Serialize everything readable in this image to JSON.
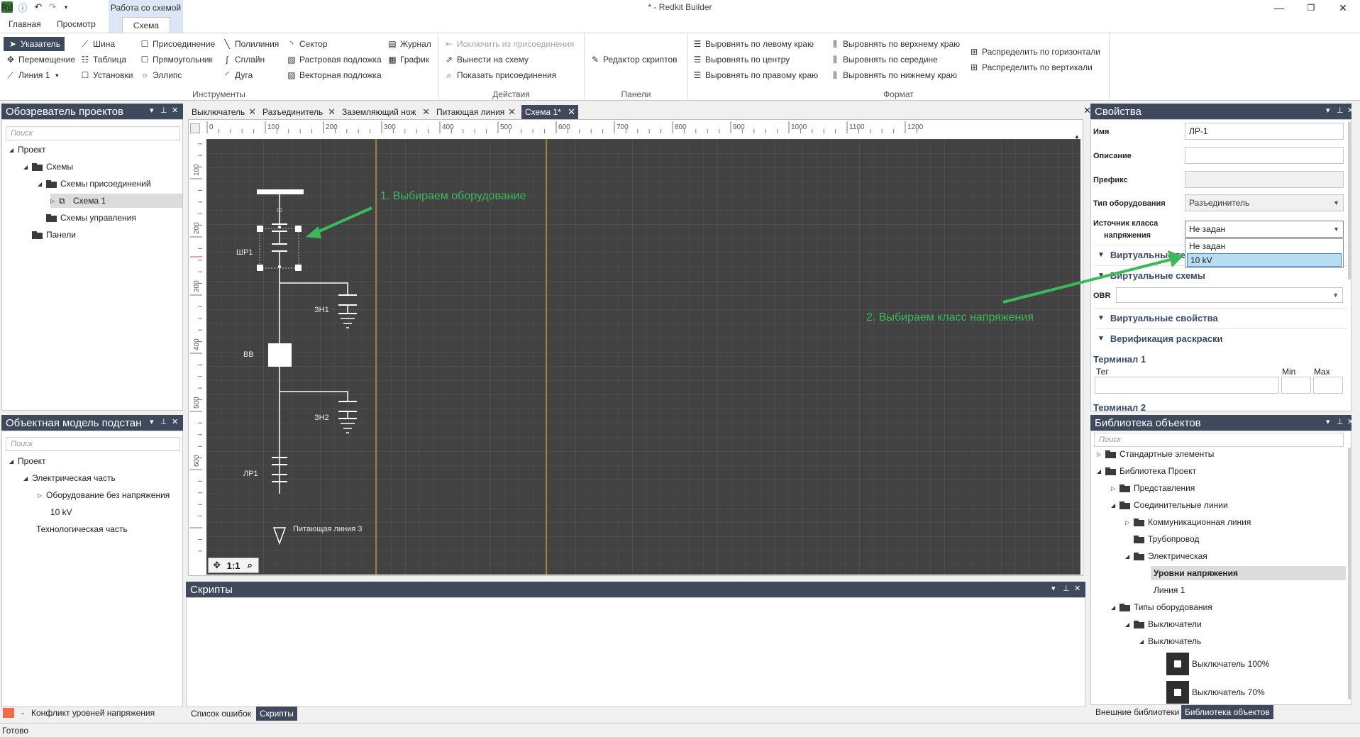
{
  "window": {
    "title": "* - Redkit Builder",
    "context_tab_title": "Работа со схемой",
    "min_icon": "minimize-icon",
    "restore_icon": "restore-icon",
    "close_icon": "close-icon"
  },
  "ribbon_tabs": [
    {
      "label": "Главная"
    },
    {
      "label": "Просмотр"
    },
    {
      "label": "Схема"
    }
  ],
  "ribbon": {
    "tools": {
      "label": "Инструменты",
      "pointer": "Указатель",
      "move": "Перемещение",
      "line": "Линия 1",
      "bus": "Шина",
      "table": "Таблица",
      "installs": "Установки",
      "connection": "Присоединение",
      "rectangle": "Прямоугольник",
      "ellipse": "Эллипс",
      "polyline": "Полилиния",
      "spline": "Сплайн",
      "arc": "Дуга",
      "sector": "Сектор",
      "raster": "Растровая подложка",
      "vector": "Векторная подложка",
      "journal": "Журнал",
      "graph": "График"
    },
    "actions": {
      "label": "Действия",
      "exclude": "Исключить из присоединения",
      "bring": "Вынести на схему",
      "show": "Показать присоединения"
    },
    "panels": {
      "label": "Панели",
      "script_editor": "Редактор скриптов"
    },
    "format": {
      "label": "Формат",
      "align_left": "Выровнять по левому краю",
      "align_center": "Выровнять по центру",
      "align_right": "Выровнять по правому краю",
      "align_top": "Выровнять по верхнему краю",
      "align_middle": "Выровнять по середине",
      "align_bottom": "Выровнять по нижнему краю",
      "dist_h": "Распределить по горизонтали",
      "dist_v": "Распределить по вертикали"
    }
  },
  "project_explorer": {
    "title": "Обозреватель проектов",
    "search_placeholder": "Поиск",
    "nodes": [
      "Проект",
      "Схемы",
      "Схемы присоединений",
      "Схема 1",
      "Схемы управления",
      "Панели"
    ]
  },
  "object_model": {
    "title": "Объектная модель подстан",
    "search_placeholder": "Поиск",
    "nodes": [
      "Проект",
      "Электрическая часть",
      "Оборудование без напряжения",
      "10 kV",
      "Технологическая часть"
    ]
  },
  "legend": {
    "dash": "-",
    "text": "Конфликт уровней напряжения",
    "color": "#f26b4a"
  },
  "doc_tabs": [
    {
      "label": "Выключатель"
    },
    {
      "label": "Разъединитель"
    },
    {
      "label": "Заземляющий нож"
    },
    {
      "label": "Питающая линия"
    },
    {
      "label": "Схема 1*"
    }
  ],
  "canvas": {
    "ruler_top": [
      "0",
      "100",
      "200",
      "300",
      "400",
      "500",
      "600",
      "700",
      "800",
      "900",
      "1000",
      "1100",
      "1200"
    ],
    "ruler_left": [
      "100",
      "200",
      "300",
      "400",
      "500",
      "600"
    ],
    "labels": {
      "shr1": "ШР1",
      "zn1": "ЗН1",
      "vv": "ВВ",
      "zn2": "ЗН2",
      "lr1": "ЛР1",
      "feeder": "Питающая линия 3"
    },
    "nav": [
      "✥",
      "1:1",
      "⌕"
    ],
    "annotation1": "1. Выбираем оборудование",
    "annotation2": "2. Выбираем класс напряжения",
    "accent": "#3db85b"
  },
  "scripts": {
    "title": "Скрипты",
    "bottom_tabs": [
      "Список ошибок",
      "Скрипты"
    ]
  },
  "properties": {
    "title": "Свойства",
    "name_label": "Имя",
    "name_value": "ЛР-1",
    "desc_label": "Описание",
    "desc_value": "",
    "prefix_label": "Префикс",
    "prefix_value": "",
    "equip_label": "Тип оборудования",
    "equip_value": "Разъединитель",
    "voltage_label_1": "Источник класса",
    "voltage_label_2": "напряжения",
    "voltage_value": "Не задан",
    "dropdown_options": [
      "Не задан",
      "10 kV"
    ],
    "sec_virtual_terms": "Виртуальные тер",
    "sec_virtual_schemes": "Виртуальные схемы",
    "obr_label": "OBR",
    "sec_virtual_props": "Виртуальные свойства",
    "sec_verification": "Верификация раскраски",
    "terminal1": "Терминал 1",
    "teg": "Тег",
    "min": "Min",
    "max": "Max",
    "terminal2": "Терминал 2"
  },
  "library": {
    "title": "Библиотека объектов",
    "search_placeholder": "Поиск",
    "nodes": [
      "Стандартные элементы",
      "Библиотека Проект",
      "Представления",
      "Соединительные линии",
      "Коммуникационная линия",
      "Трубопровод",
      "Электрическая",
      "Уровни напряжения",
      "Линия 1",
      "Типы оборудования",
      "Выключатели",
      "Выключатель",
      "Выключатель 100%",
      "Выключатель 70%"
    ],
    "bottom_tabs": [
      "Внешние библиотеки",
      "Библиотека объектов"
    ]
  },
  "status": {
    "text": "Готово"
  }
}
